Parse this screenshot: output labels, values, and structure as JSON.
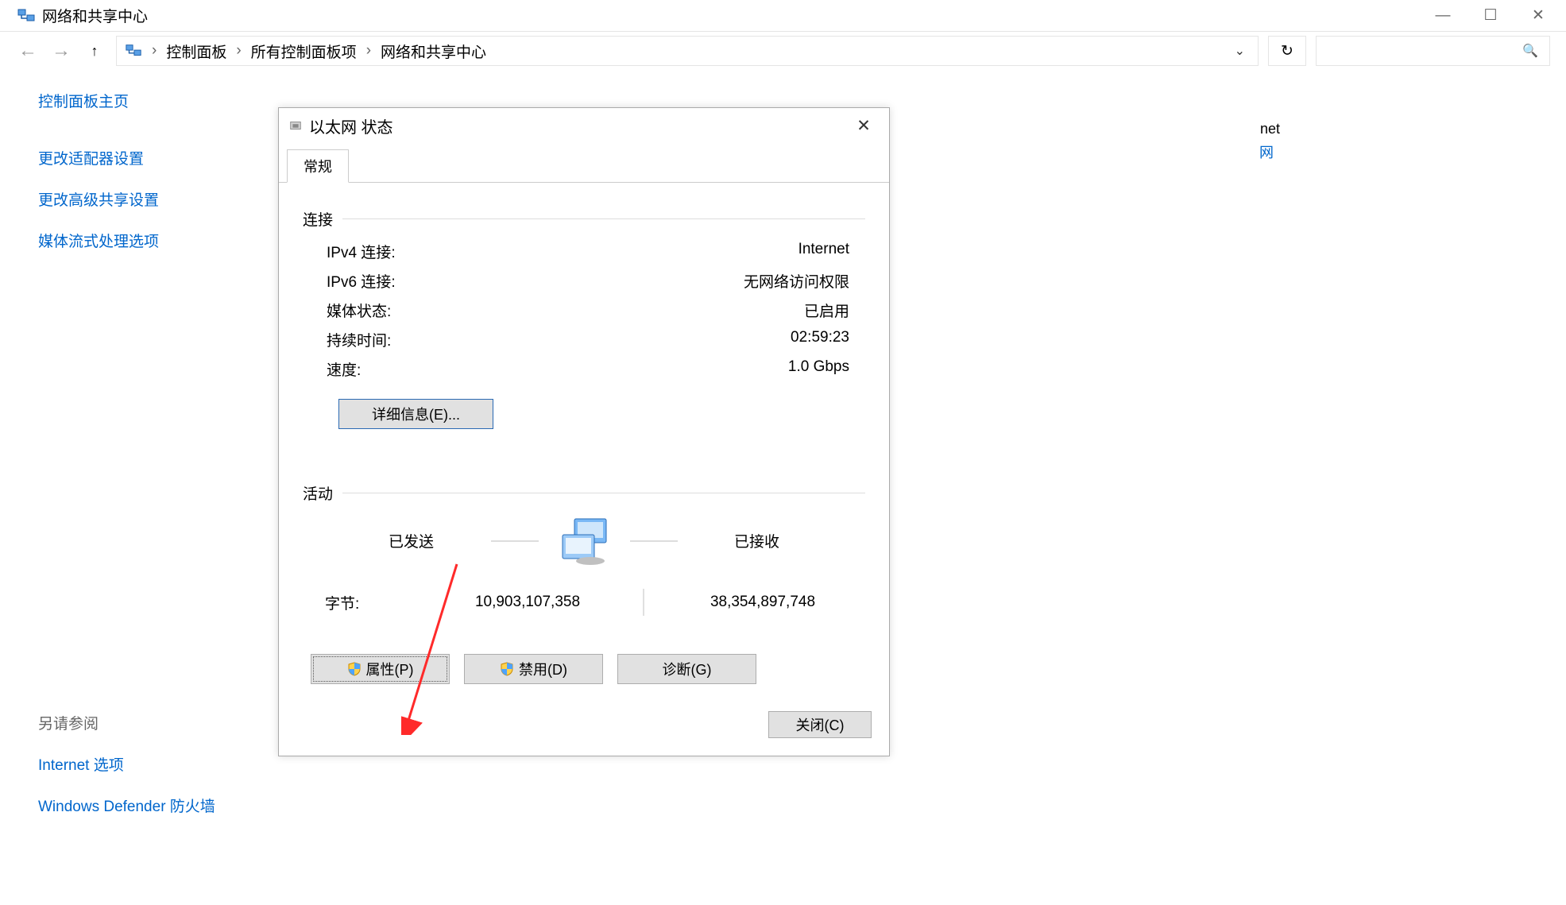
{
  "window": {
    "title": "网络和共享中心"
  },
  "window_controls": {
    "min": "—",
    "max": "☐",
    "close": "✕"
  },
  "nav": {
    "back": "←",
    "forward": "→",
    "up": "↑"
  },
  "breadcrumb": {
    "items": [
      "控制面板",
      "所有控制面板项",
      "网络和共享中心"
    ],
    "sep": "›",
    "dropdown": "⌄"
  },
  "refresh": "↻",
  "search": {
    "placeholder": "",
    "icon": "🔍"
  },
  "sidebar": {
    "home": "控制面板主页",
    "links": [
      "更改适配器设置",
      "更改高级共享设置",
      "媒体流式处理选项"
    ],
    "see_also_title": "另请参阅",
    "see_also": [
      "Internet 选项",
      "Windows Defender 防火墙"
    ]
  },
  "peek": {
    "net": "net",
    "net_link": "网"
  },
  "dialog": {
    "title": "以太网 状态",
    "close": "✕",
    "tab": "常规",
    "section_conn": "连接",
    "rows": [
      {
        "k": "IPv4 连接",
        "v": "Internet"
      },
      {
        "k": "IPv6 连接",
        "v": "无网络访问权限"
      },
      {
        "k": "媒体状态",
        "v": "已启用"
      },
      {
        "k": "持续时间",
        "v": "02:59:23"
      },
      {
        "k": "速度",
        "v": "1.0 Gbps"
      }
    ],
    "details_btn": "详细信息(E)...",
    "section_activity": "活动",
    "sent_label": "已发送",
    "recv_label": "已接收",
    "bytes_label": "字节",
    "bytes_sent": "10,903,107,358",
    "bytes_recv": "38,354,897,748",
    "btn_properties": "属性(P)",
    "btn_disable": "禁用(D)",
    "btn_diagnose": "诊断(G)",
    "btn_close": "关闭(C)"
  }
}
